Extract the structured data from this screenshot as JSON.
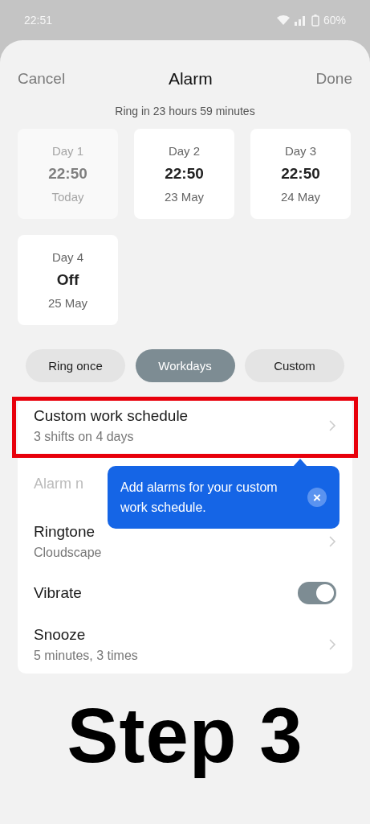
{
  "status_bar": {
    "time": "22:51",
    "battery": "60%"
  },
  "header": {
    "cancel": "Cancel",
    "title": "Alarm",
    "done": "Done",
    "subtitle": "Ring in 23 hours 59 minutes"
  },
  "days": [
    {
      "label": "Day 1",
      "time": "22:50",
      "date": "Today",
      "disabled": true
    },
    {
      "label": "Day 2",
      "time": "22:50",
      "date": "23 May",
      "disabled": false
    },
    {
      "label": "Day 3",
      "time": "22:50",
      "date": "24 May",
      "disabled": false
    },
    {
      "label": "Day 4",
      "time": "Off",
      "date": "25 May",
      "disabled": false
    }
  ],
  "repeat_options": [
    {
      "label": "Ring once",
      "selected": false
    },
    {
      "label": "Workdays",
      "selected": true
    },
    {
      "label": "Custom",
      "selected": false
    }
  ],
  "settings": [
    {
      "kind": "nav",
      "title": "Custom work schedule",
      "subtitle": "3 shifts on 4 days",
      "highlighted": true
    },
    {
      "kind": "field",
      "placeholder": "Alarm n",
      "highlighted": false
    },
    {
      "kind": "nav",
      "title": "Ringtone",
      "subtitle": "Cloudscape",
      "highlighted": false
    },
    {
      "kind": "toggle",
      "title": "Vibrate",
      "on": true,
      "highlighted": false
    },
    {
      "kind": "nav",
      "title": "Snooze",
      "subtitle": "5 minutes, 3 times",
      "highlighted": false
    }
  ],
  "tooltip": {
    "text": "Add alarms for your custom work schedule.",
    "close": "×"
  },
  "caption": "Step 3"
}
